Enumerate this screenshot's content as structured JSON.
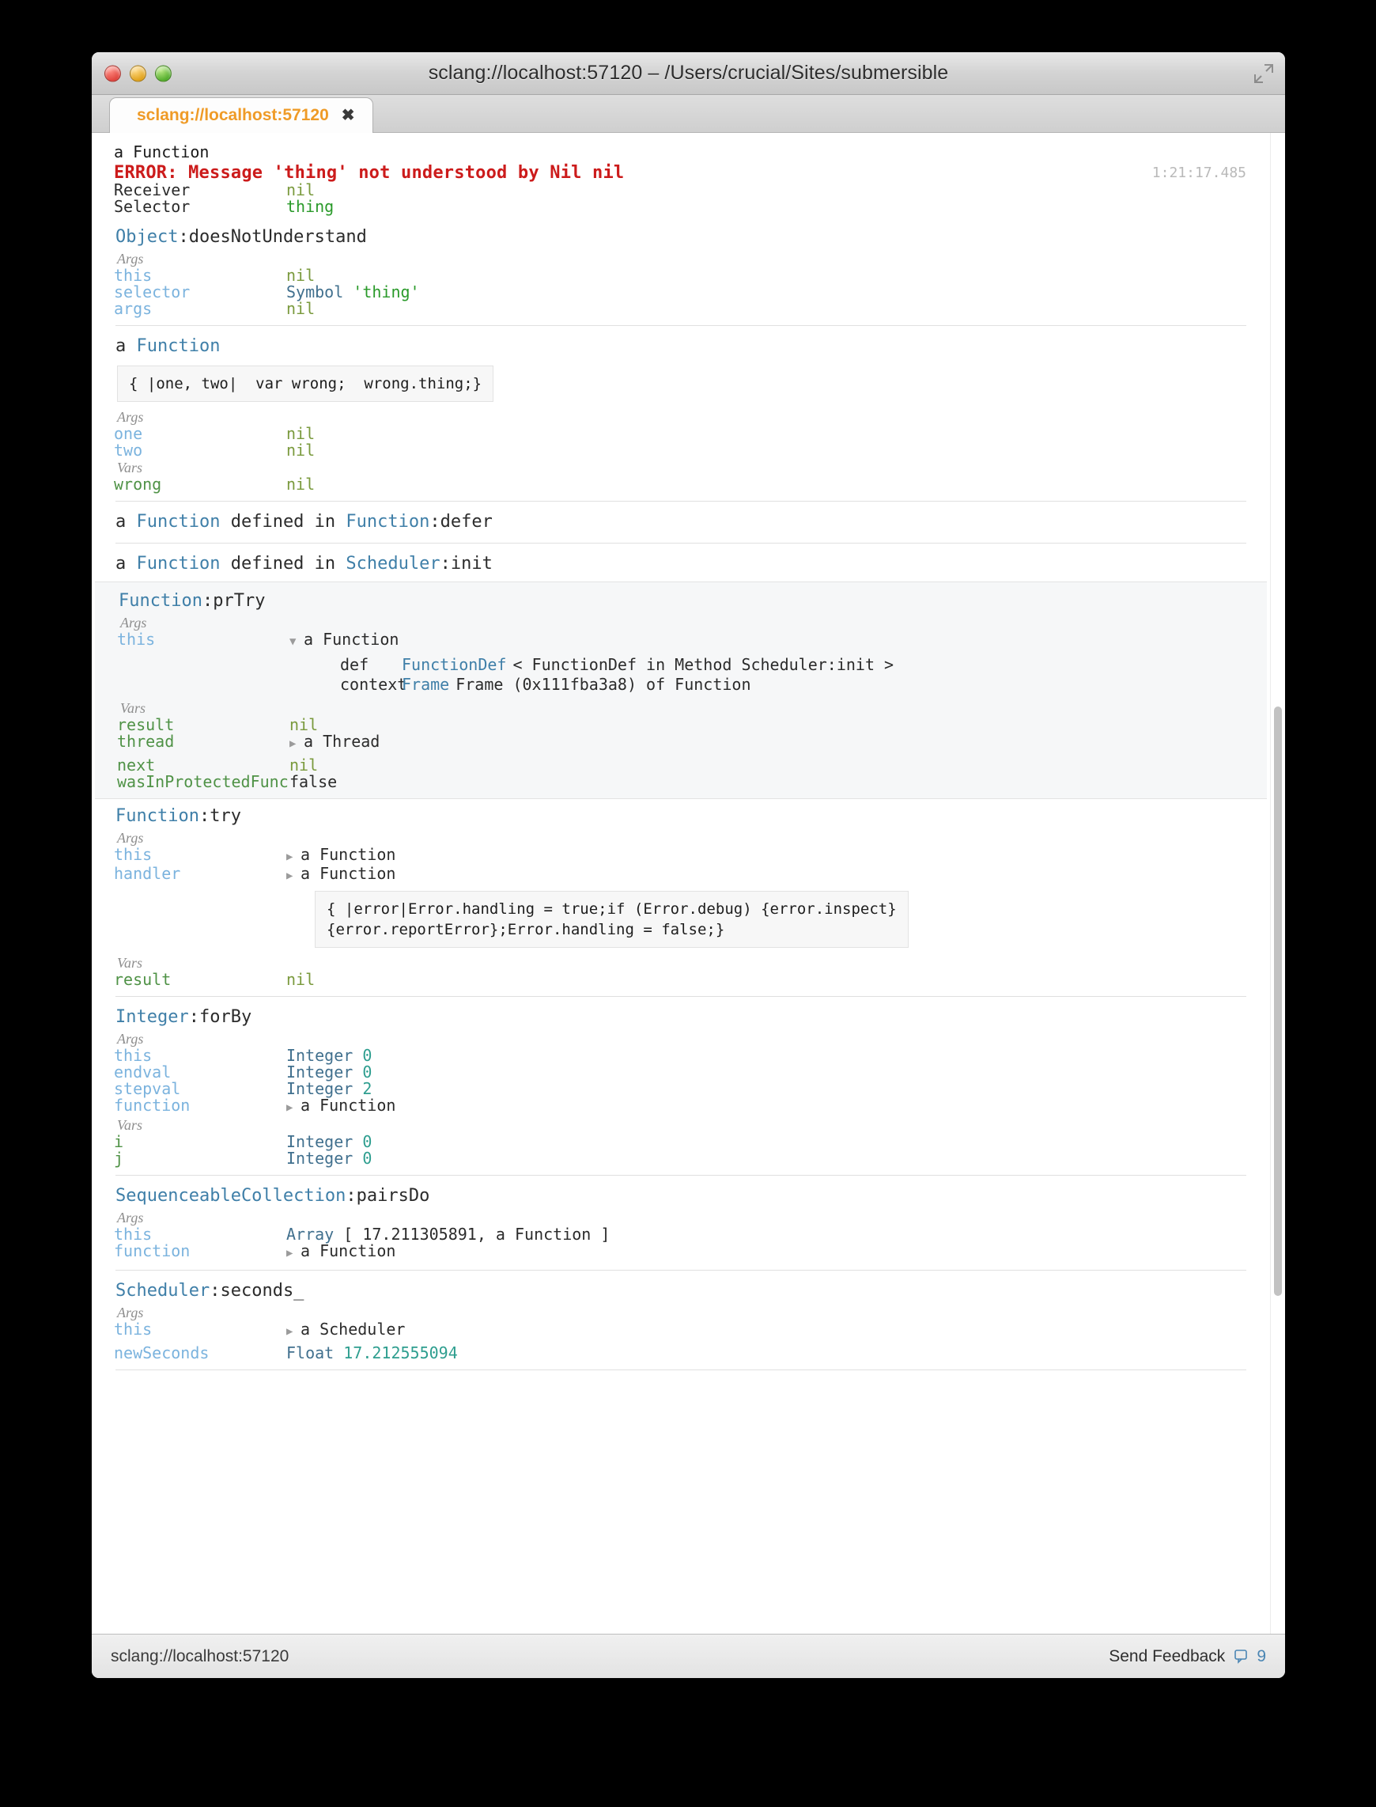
{
  "window": {
    "title": "sclang://localhost:57120 – /Users/crucial/Sites/submersible",
    "traffic": {
      "close": "close-button",
      "minimize": "minimize-button",
      "zoom": "zoom-button"
    }
  },
  "tab": {
    "label": "sclang://localhost:57120",
    "close": "✖"
  },
  "statusbar": {
    "address": "sclang://localhost:57120",
    "feedback": "Send Feedback",
    "count": "9"
  },
  "content": {
    "top_line": "a Function",
    "error_line": "ERROR: Message 'thing' not understood by Nil nil",
    "timestamp": "1:21:17.485",
    "receiver": {
      "label": "Receiver",
      "value": "nil"
    },
    "selector": {
      "label": "Selector",
      "value": "thing"
    },
    "labels": {
      "args": "Args",
      "vars": "Vars"
    },
    "frame1": {
      "class": "Object",
      "sep": ":",
      "method": "doesNotUnderstand",
      "args": [
        {
          "name": "this",
          "type": "",
          "value": "nil"
        },
        {
          "name": "selector",
          "type": "Symbol",
          "value": "'thing'"
        },
        {
          "name": "args",
          "type": "",
          "value": "nil"
        }
      ]
    },
    "frame2": {
      "prefix": "a ",
      "class": "Function",
      "code": "{ |one, two|  var wrong;  wrong.thing;}",
      "args": [
        {
          "name": "one",
          "value": "nil"
        },
        {
          "name": "two",
          "value": "nil"
        }
      ],
      "vars": [
        {
          "name": "wrong",
          "value": "nil"
        }
      ]
    },
    "frame3": {
      "text_a": "a ",
      "cls": "Function",
      "mid": " defined in ",
      "cls2": "Function",
      "sep": ":",
      "method": "defer"
    },
    "frame4": {
      "text_a": "a ",
      "cls": "Function",
      "mid": " defined in ",
      "cls2": "Scheduler",
      "sep": ":",
      "method": "init"
    },
    "frame5": {
      "class": "Function",
      "sep": ":",
      "method": "prTry",
      "args": [
        {
          "name": "this",
          "tri": "▼",
          "value": "a Function"
        }
      ],
      "detail": [
        {
          "key": "def",
          "type": "FunctionDef",
          "value": "< FunctionDef in Method Scheduler:init >"
        },
        {
          "key": "context",
          "type": "Frame",
          "value": "Frame (0x111fba3a8) of Function"
        }
      ],
      "vars": [
        {
          "name": "result",
          "tri": "",
          "value": "nil"
        },
        {
          "name": "thread",
          "tri": "▶",
          "value": "a Thread"
        },
        {
          "name": "next",
          "tri": "",
          "value": "nil"
        },
        {
          "name": "wasInProtectedFunc",
          "tri": "",
          "value": "false"
        }
      ]
    },
    "frame6": {
      "class": "Function",
      "sep": ":",
      "method": "try",
      "args": [
        {
          "name": "this",
          "tri": "▶",
          "value": "a Function"
        },
        {
          "name": "handler",
          "tri": "▶",
          "value": "a Function"
        }
      ],
      "code": "{ |error|Error.handling = true;if (Error.debug) {error.inspect}\n{error.reportError};Error.handling = false;}",
      "vars": [
        {
          "name": "result",
          "value": "nil"
        }
      ]
    },
    "frame7": {
      "class": "Integer",
      "sep": ":",
      "method": "forBy",
      "args": [
        {
          "name": "this",
          "type": "Integer",
          "value": "0"
        },
        {
          "name": "endval",
          "type": "Integer",
          "value": "0"
        },
        {
          "name": "stepval",
          "type": "Integer",
          "value": "2"
        },
        {
          "name": "function",
          "tri": "▶",
          "value": "a Function"
        }
      ],
      "vars": [
        {
          "name": "i",
          "type": "Integer",
          "value": "0"
        },
        {
          "name": "j",
          "type": "Integer",
          "value": "0"
        }
      ]
    },
    "frame8": {
      "class": "SequenceableCollection",
      "sep": ":",
      "method": "pairsDo",
      "args": [
        {
          "name": "this",
          "type": "Array",
          "value": "[ 17.211305891, a Function ]"
        },
        {
          "name": "function",
          "tri": "▶",
          "value": "a Function"
        }
      ]
    },
    "frame9": {
      "class": "Scheduler",
      "sep": ":",
      "method": "seconds_",
      "args": [
        {
          "name": "this",
          "tri": "▶",
          "value": "a Scheduler"
        },
        {
          "name": "newSeconds",
          "type": "Float",
          "value": "17.212555094"
        }
      ]
    }
  }
}
